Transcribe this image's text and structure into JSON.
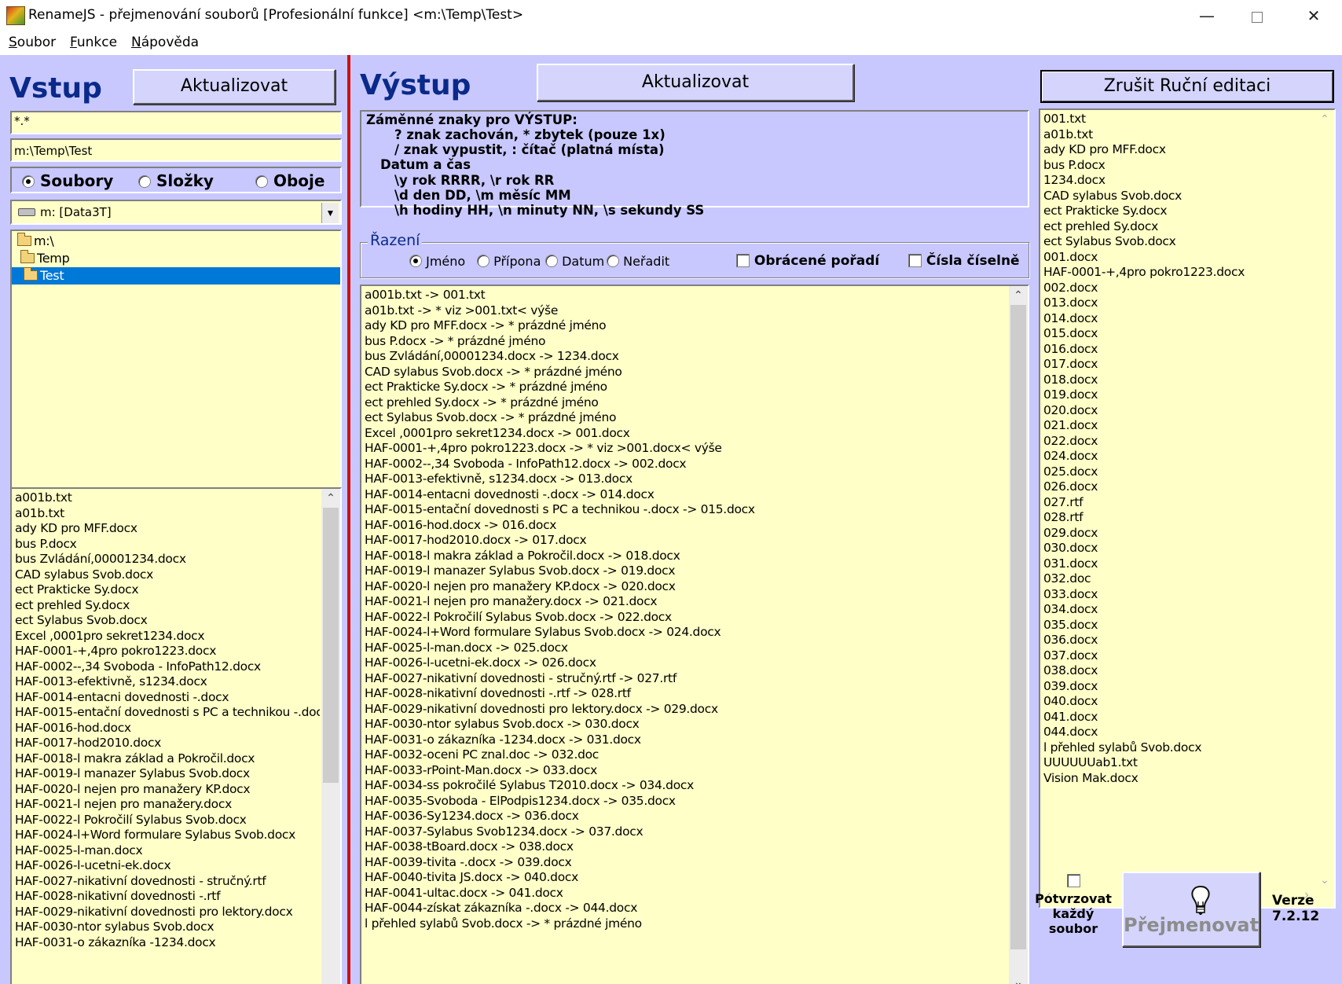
{
  "window": {
    "title": "RenameJS - přejmenování souborů [Profesionální funkce] <m:\\Temp\\Test>",
    "minimize_glyph": "—",
    "close_glyph": "✕"
  },
  "menu": {
    "items": [
      {
        "first": "S",
        "rest": "oubor"
      },
      {
        "first": "F",
        "rest": "unkce"
      },
      {
        "first": "N",
        "rest": "ápověda"
      }
    ]
  },
  "input_panel": {
    "heading": "Vstup",
    "refresh_label": "Aktualizovat",
    "mask_value": "*.*",
    "path_value": "m:\\Temp\\Test",
    "mode": {
      "options": [
        "Soubory",
        "Složky",
        "Oboje"
      ],
      "selected": "Soubory"
    },
    "drive_value": "m: [Data3T]",
    "folders": [
      {
        "name": "m:\\",
        "selected": false
      },
      {
        "name": "Temp",
        "selected": false
      },
      {
        "name": "Test",
        "selected": true
      }
    ],
    "files": [
      "a001b.txt",
      "a01b.txt",
      "ady KD pro MFF.docx",
      "bus P.docx",
      "bus Zvládání,00001234.docx",
      "CAD sylabus Svob.docx",
      "ect Prakticke Sy.docx",
      "ect prehled Sy.docx",
      "ect Sylabus Svob.docx",
      "Excel ,0001pro sekret1234.docx",
      "HAF-0001-+,4pro pokro1223.docx",
      "HAF-0002--,34 Svoboda - InfoPath12.docx",
      "HAF-0013-efektivně, s1234.docx",
      "HAF-0014-entacni dovednosti -.docx",
      "HAF-0015-entační dovednosti s PC a technikou -.docx",
      "HAF-0016-hod.docx",
      "HAF-0017-hod2010.docx",
      "HAF-0018-l makra základ a Pokročil.docx",
      "HAF-0019-l manazer Sylabus Svob.docx",
      "HAF-0020-l nejen pro manažery KP.docx",
      "HAF-0021-l nejen pro manažery.docx",
      "HAF-0022-l Pokročilí Sylabus Svob.docx",
      "HAF-0024-l+Word formulare Sylabus Svob.docx",
      "HAF-0025-l-man.docx",
      "HAF-0026-l-ucetni-ek.docx",
      "HAF-0027-nikativní dovednosti - stručný.rtf",
      "HAF-0028-nikativní dovednosti -.rtf",
      "HAF-0029-nikativní dovednosti pro lektory.docx",
      "HAF-0030-ntor sylabus Svob.docx",
      "HAF-0031-o zákazníka -1234.docx"
    ]
  },
  "output_panel": {
    "heading": "Výstup",
    "refresh_label": "Aktualizovat",
    "help_lines": [
      "Záměnné znaky pro VÝSTUP:",
      "? znak zachován, * zbytek (pouze 1x)",
      "/ znak vypustit, : čítač (platná místa)",
      "Datum a čas",
      "\\y rok RRRR, \\r rok RR",
      "\\d den DD, \\m měsíc MM",
      "\\h hodiny HH, \\n minuty NN, \\s sekundy SS"
    ],
    "sort": {
      "label": "Řazení",
      "options": [
        "Jméno",
        "Přípona",
        "Datum",
        "Neřadit"
      ],
      "selected": "Jméno",
      "reverse_label": "Obrácené pořadí",
      "numeric_label": "Čísla číselně"
    },
    "preview": [
      "a001b.txt -> 001.txt",
      "a01b.txt -> * viz >001.txt< výše",
      "ady KD pro MFF.docx -> * prázdné jméno",
      "bus P.docx -> * prázdné jméno",
      "bus Zvládání,00001234.docx -> 1234.docx",
      "CAD sylabus Svob.docx -> * prázdné jméno",
      "ect Prakticke Sy.docx -> * prázdné jméno",
      "ect prehled Sy.docx -> * prázdné jméno",
      "ect Sylabus Svob.docx -> * prázdné jméno",
      "Excel ,0001pro sekret1234.docx -> 001.docx",
      "HAF-0001-+,4pro pokro1223.docx -> * viz >001.docx< výše",
      "HAF-0002--,34 Svoboda - InfoPath12.docx -> 002.docx",
      "HAF-0013-efektivně, s1234.docx -> 013.docx",
      "HAF-0014-entacni dovednosti -.docx -> 014.docx",
      "HAF-0015-entační dovednosti s PC a technikou -.docx -> 015.docx",
      "HAF-0016-hod.docx -> 016.docx",
      "HAF-0017-hod2010.docx -> 017.docx",
      "HAF-0018-l makra základ a Pokročil.docx -> 018.docx",
      "HAF-0019-l manazer Sylabus Svob.docx -> 019.docx",
      "HAF-0020-l nejen pro manažery KP.docx -> 020.docx",
      "HAF-0021-l nejen pro manažery.docx -> 021.docx",
      "HAF-0022-l Pokročilí Sylabus Svob.docx -> 022.docx",
      "HAF-0024-l+Word formulare Sylabus Svob.docx -> 024.docx",
      "HAF-0025-l-man.docx -> 025.docx",
      "HAF-0026-l-ucetni-ek.docx -> 026.docx",
      "HAF-0027-nikativní dovednosti - stručný.rtf -> 027.rtf",
      "HAF-0028-nikativní dovednosti -.rtf -> 028.rtf",
      "HAF-0029-nikativní dovednosti pro lektory.docx -> 029.docx",
      "HAF-0030-ntor sylabus Svob.docx -> 030.docx",
      "HAF-0031-o zákazníka -1234.docx -> 031.docx",
      "HAF-0032-oceni PC znal.doc -> 032.doc",
      "HAF-0033-rPoint-Man.docx -> 033.docx",
      "HAF-0034-ss  pokročilé Sylabus T2010.docx -> 034.docx",
      "HAF-0035-Svoboda - ElPodpis1234.docx -> 035.docx",
      "HAF-0036-Sy1234.docx -> 036.docx",
      "HAF-0037-Sylabus Svob1234.docx -> 037.docx",
      "HAF-0038-tBoard.docx -> 038.docx",
      "HAF-0039-tivita -.docx -> 039.docx",
      "HAF-0040-tivita JS.docx -> 040.docx",
      "HAF-0041-ultac.docx -> 041.docx",
      "HAF-0044-získat zákazníka -.docx -> 044.docx",
      "l přehled sylabů Svob.docx -> * prázdné jméno"
    ]
  },
  "result_panel": {
    "cancel_label": "Zrušit Ruční editaci",
    "names": [
      "001.txt",
      "a01b.txt",
      "ady KD pro MFF.docx",
      "bus P.docx",
      "1234.docx",
      "CAD sylabus Svob.docx",
      "ect Prakticke Sy.docx",
      "ect prehled Sy.docx",
      "ect Sylabus Svob.docx",
      "001.docx",
      "HAF-0001-+,4pro pokro1223.docx",
      "002.docx",
      "013.docx",
      "014.docx",
      "015.docx",
      "016.docx",
      "017.docx",
      "018.docx",
      "019.docx",
      "020.docx",
      "021.docx",
      "022.docx",
      "024.docx",
      "025.docx",
      "026.docx",
      "027.rtf",
      "028.rtf",
      "029.docx",
      "030.docx",
      "031.docx",
      "032.doc",
      "033.docx",
      "034.docx",
      "035.docx",
      "036.docx",
      "037.docx",
      "038.docx",
      "039.docx",
      "040.docx",
      "041.docx",
      "044.docx",
      "l přehled sylabů Svob.docx",
      "UUUUUUab1.txt",
      "Vision Mak.docx"
    ],
    "confirm_lines": [
      "Potvrzovat",
      "každý",
      "soubor"
    ],
    "rename_label": "Přejmenovat",
    "version_lines": [
      "Verze",
      "7.2.12"
    ]
  },
  "colors": {
    "panel_bg": "#c8c8ff",
    "field_bg": "#ffffc8",
    "heading": "#0a2a8a",
    "divider": "#d01010",
    "selection": "#0078d7"
  }
}
